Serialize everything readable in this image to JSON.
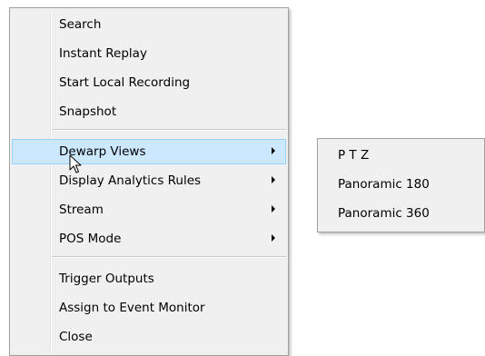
{
  "context_menu": {
    "items": [
      {
        "label": "Search"
      },
      {
        "label": "Instant Replay"
      },
      {
        "label": "Start Local Recording"
      },
      {
        "label": "Snapshot"
      },
      {
        "label": "Dewarp Views"
      },
      {
        "label": "Display Analytics Rules"
      },
      {
        "label": "Stream"
      },
      {
        "label": "POS Mode"
      },
      {
        "label": "Trigger Outputs"
      },
      {
        "label": "Assign to Event Monitor"
      },
      {
        "label": "Close"
      }
    ],
    "highlighted": "Dewarp Views"
  },
  "submenu": {
    "parent": "Dewarp Views",
    "items": [
      {
        "label": "P T Z"
      },
      {
        "label": "Panoramic 180"
      },
      {
        "label": "Panoramic 360"
      }
    ]
  },
  "colors": {
    "menu_background": "#f0f0f0",
    "highlight_background": "#cce8ff",
    "highlight_border": "#99d1ff"
  }
}
